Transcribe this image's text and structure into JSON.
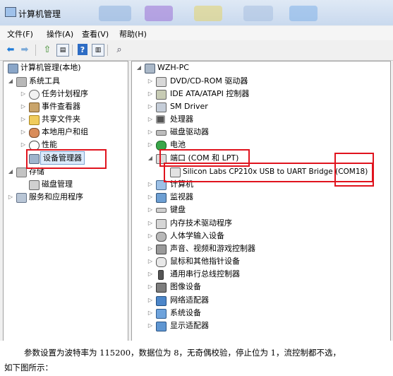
{
  "window": {
    "title": "计算机管理"
  },
  "menu": [
    "文件(F)",
    "操作(A)",
    "查看(V)",
    "帮助(H)"
  ],
  "toolbar_icons": [
    "back-icon",
    "forward-icon",
    "up-folder-icon",
    "properties-icon",
    "help-icon",
    "show-hide-icon",
    "scan-hardware-icon"
  ],
  "left_tree": [
    {
      "label": "计算机管理(本地)",
      "icon": "computer-management-icon"
    },
    {
      "label": "系统工具",
      "icon": "tools-icon"
    },
    {
      "label": "任务计划程序",
      "icon": "clock-icon"
    },
    {
      "label": "事件查看器",
      "icon": "event-viewer-icon"
    },
    {
      "label": "共享文件夹",
      "icon": "shared-folder-icon"
    },
    {
      "label": "本地用户和组",
      "icon": "users-icon"
    },
    {
      "label": "性能",
      "icon": "performance-icon"
    },
    {
      "label": "设备管理器",
      "icon": "device-manager-icon"
    },
    {
      "label": "存储",
      "icon": "storage-icon"
    },
    {
      "label": "磁盘管理",
      "icon": "disk-management-icon"
    },
    {
      "label": "服务和应用程序",
      "icon": "services-icon"
    }
  ],
  "device_tree": {
    "root": "WZH-PC",
    "items": [
      "DVD/CD-ROM 驱动器",
      "IDE ATA/ATAPI 控制器",
      "SM Driver",
      "处理器",
      "磁盘驱动器",
      "电池",
      "端口 (COM 和 LPT)",
      "Silicon Labs CP210x USB to UART Bridge (COM18)",
      "计算机",
      "监视器",
      "键盘",
      "内存技术驱动程序",
      "人体学输入设备",
      "声音、视频和游戏控制器",
      "鼠标和其他指针设备",
      "通用串行总线控制器",
      "图像设备",
      "网络适配器",
      "系统设备",
      "显示适配器"
    ]
  },
  "caption": {
    "line1": "参数设置为波特率为 115200，数据位为 8，无奇偶校验，停止位为 1，流控制都不选，",
    "line2": "如下图所示："
  },
  "colors": {
    "highlight": "#e0141e",
    "selection": "#dcebfc"
  }
}
